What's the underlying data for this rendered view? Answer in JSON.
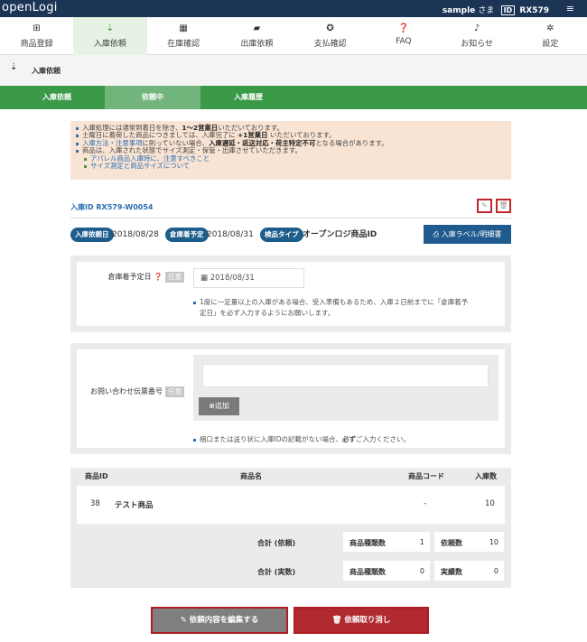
{
  "header": {
    "logo": "openLogi",
    "user_name": "sample",
    "user_suffix": "さま",
    "id_label": "ID",
    "id_value": "RX579",
    "menu_glyph": "≡"
  },
  "nav": [
    {
      "label": "商品登録",
      "icon": "box-icon",
      "glyph": "⊞"
    },
    {
      "label": "入庫依頼",
      "icon": "inbound-icon",
      "glyph": "⇣",
      "active": true
    },
    {
      "label": "在庫確認",
      "icon": "stock-icon",
      "glyph": "▦"
    },
    {
      "label": "出庫依頼",
      "icon": "truck-icon",
      "glyph": "▰"
    },
    {
      "label": "支払確認",
      "icon": "gear-icon",
      "glyph": "✪"
    },
    {
      "label": "FAQ",
      "icon": "question-icon",
      "glyph": "❓"
    },
    {
      "label": "お知らせ",
      "icon": "bell-icon",
      "glyph": "♪"
    },
    {
      "label": "設定",
      "icon": "settings-icon",
      "glyph": "✲"
    }
  ],
  "page": {
    "title": "入庫依頼",
    "icon_glyph": "⇣"
  },
  "subtabs": [
    "入庫依頼",
    "依頼中",
    "入庫履歴"
  ],
  "notice": {
    "l1a": "入庫処理には通常到着日を除き、",
    "l1b": "1〜2営業日",
    "l1c": "いただいております。",
    "l2a": "土曜日に着荷した商品につきましては、入庫完了に ",
    "l2b": "+1営業日",
    "l2c": " いただいております。",
    "l3a": "入庫方法・注意事項",
    "l3b": "に則っていない場合、",
    "l3c": "入庫遅延・返送対応・荷主特定不可",
    "l3d": "となる場合があります。",
    "l4": "商品は、入庫された状態でサイズ測定・保管・出庫させていただきます。",
    "l5": "アパレル商品入庫時に、注意すべきこと",
    "l6": "サイズ測定と商品サイズについて"
  },
  "request": {
    "id_text": "入庫ID RX579-W0054",
    "edit_glyph": "✎",
    "delete_glyph": "🗑",
    "request_date_label": "入庫依頼日",
    "request_date": "2018/08/28",
    "arrival_label": "倉庫着予定",
    "arrival_date": "2018/08/31",
    "inspect_label": "検品タイプ",
    "inspect_value": "オープンロジ商品ID",
    "label_button": "入庫ラベル/明細書",
    "label_button_glyph": "⎙"
  },
  "arrival_form": {
    "label": "倉庫着予定日",
    "help_glyph": "❓",
    "optional": "任意",
    "value": "2018/08/31",
    "calendar_glyph": "▦",
    "help_line1": "1度に一定量以上の入庫がある場合、受入準備もあるため、入庫２日前までに「倉庫着予",
    "help_line2": "定日」を必ず入力するようにお願いします。"
  },
  "tracking_form": {
    "label": "お問い合わせ伝票番号",
    "optional": "任意",
    "value": "",
    "add_button": "追加",
    "add_glyph": "⊕",
    "help_a": "梱口または送り状に入庫IDの記載がない場合、",
    "help_b": "必ず",
    "help_c": "ご入力ください。"
  },
  "table": {
    "headers": [
      "商品ID",
      "商品名",
      "商品コード",
      "入庫数"
    ],
    "rows": [
      {
        "id": "38",
        "name": "テスト商品",
        "code": "-",
        "qty": "10"
      }
    ],
    "summary": {
      "request_label": "合計 (依頼)",
      "actual_label": "合計 (実数)",
      "kinds_label": "商品種類数",
      "request_count_label": "依頼数",
      "actual_count_label": "実績数",
      "request_kinds": "1",
      "request_count": "10",
      "actual_kinds": "0",
      "actual_count": "0"
    }
  },
  "actions": {
    "edit_label": "依頼内容を編集する",
    "edit_glyph": "✎",
    "cancel_label": "依頼取り消し",
    "cancel_glyph": "🗑"
  },
  "colors": {
    "topbar": "#1c3557",
    "green": "#3a9a48",
    "green_active": "#72b57c",
    "blue": "#1f5b8e",
    "red": "#b01c22",
    "notice_bg": "#f9e4d4"
  }
}
